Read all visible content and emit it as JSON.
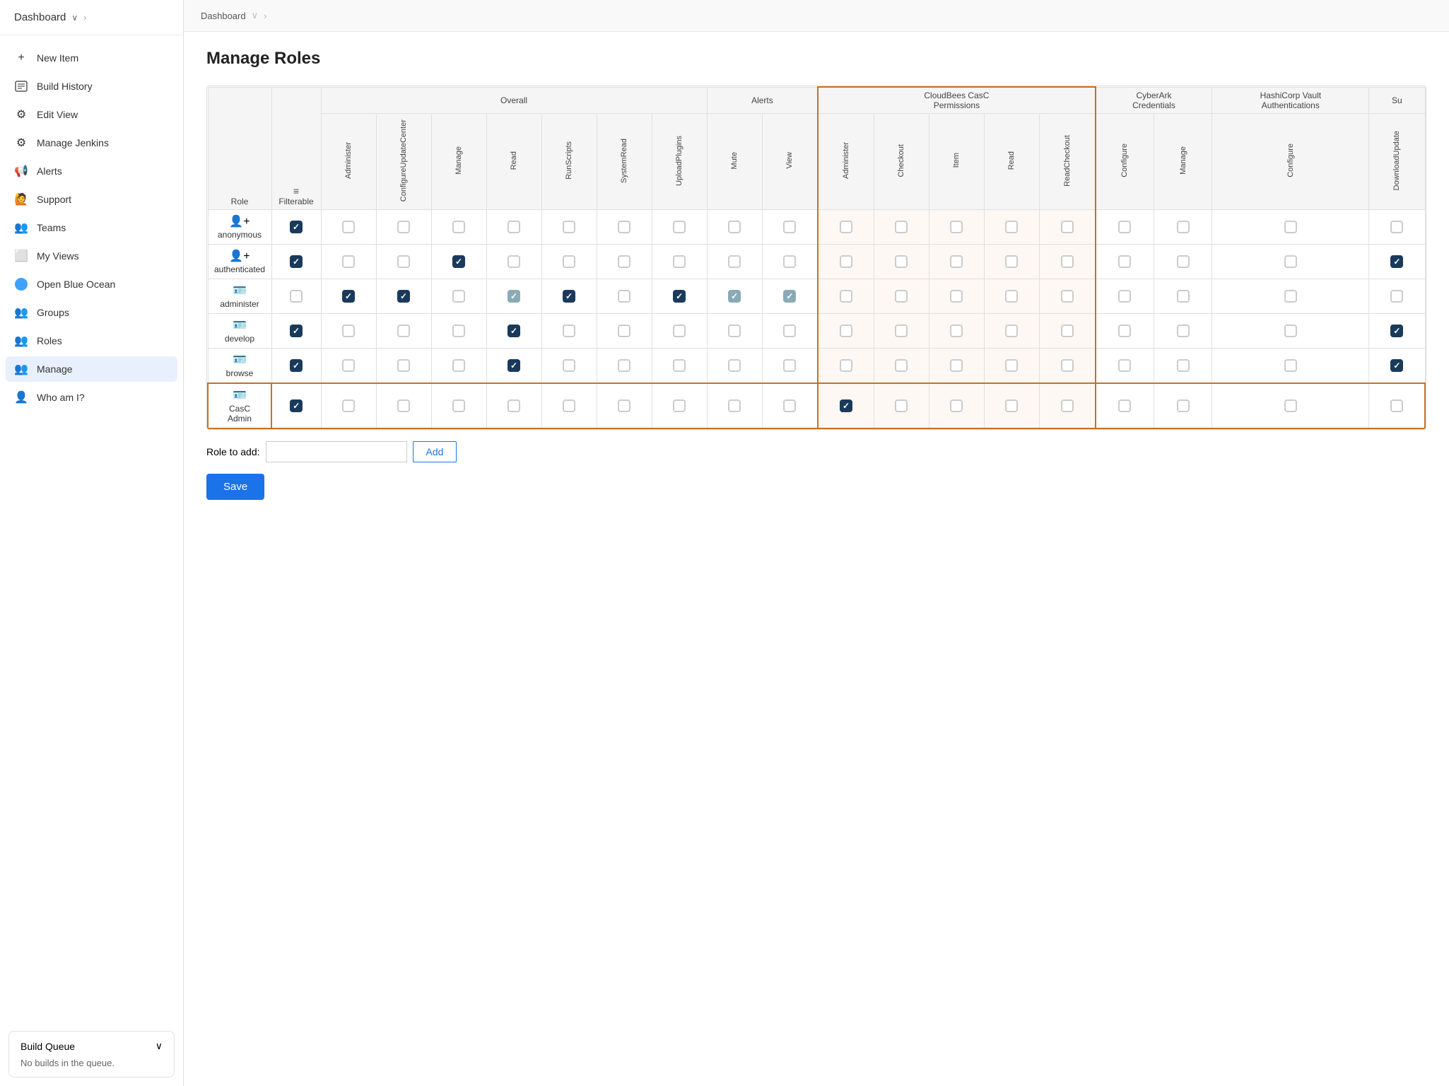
{
  "breadcrumb": {
    "items": [
      "Dashboard"
    ]
  },
  "sidebar": {
    "header": "Dashboard",
    "nav_items": [
      {
        "id": "new-item",
        "label": "New Item",
        "icon": "+"
      },
      {
        "id": "build-history",
        "label": "Build History",
        "icon": "📋"
      },
      {
        "id": "edit-view",
        "label": "Edit View",
        "icon": "⚙"
      },
      {
        "id": "manage-jenkins",
        "label": "Manage Jenkins",
        "icon": "⚙"
      },
      {
        "id": "alerts",
        "label": "Alerts",
        "icon": "🔔"
      },
      {
        "id": "support",
        "label": "Support",
        "icon": "👤"
      },
      {
        "id": "teams",
        "label": "Teams",
        "icon": "👥"
      },
      {
        "id": "my-views",
        "label": "My Views",
        "icon": "⬜"
      },
      {
        "id": "open-blue-ocean",
        "label": "Open Blue Ocean",
        "icon": "🔵"
      },
      {
        "id": "groups",
        "label": "Groups",
        "icon": "👥"
      },
      {
        "id": "roles",
        "label": "Roles",
        "icon": "👥"
      },
      {
        "id": "manage",
        "label": "Manage",
        "icon": "👥",
        "active": true,
        "sub": true
      },
      {
        "id": "who-am-i",
        "label": "Who am I?",
        "icon": "👤"
      }
    ],
    "build_queue": {
      "title": "Build Queue",
      "body": "No builds in the queue."
    }
  },
  "page": {
    "title": "Manage Roles",
    "table": {
      "role_col": "Role",
      "filterable_col": "Filterable",
      "groups": [
        {
          "label": "Overall",
          "cols": [
            "Administer",
            "ConfigureUpdateCenter",
            "Manage",
            "Read",
            "RunScripts",
            "SystemRead",
            "UploadPlugins"
          ]
        },
        {
          "label": "Alerts",
          "cols": [
            "Mute",
            "View"
          ]
        },
        {
          "label": "CloudBees CasC Permissions",
          "cols": [
            "Administer",
            "Checkout",
            "Item",
            "Read",
            "ReadCheckout"
          ],
          "highlight": true
        },
        {
          "label": "CyberArk Credentials",
          "cols": [
            "Configure",
            "Manage"
          ]
        },
        {
          "label": "HashiCorp Vault Authentications",
          "cols": [
            "Configure"
          ]
        },
        {
          "label": "Su",
          "cols": [
            "DownloadUpdate"
          ]
        }
      ],
      "rows": [
        {
          "name": "anonymous",
          "icon": "person_add",
          "filterable": true,
          "overall": [
            false,
            false,
            false,
            false,
            false,
            false,
            false
          ],
          "alerts": [
            false,
            false
          ],
          "casc": [
            false,
            false,
            false,
            false,
            false
          ],
          "cyberark": [
            false,
            false
          ],
          "hashicorp": [
            false
          ],
          "su": [
            false
          ]
        },
        {
          "name": "authenticated",
          "icon": "person_add",
          "filterable": true,
          "overall": [
            false,
            false,
            true,
            false,
            false,
            false,
            false
          ],
          "alerts": [
            false,
            false
          ],
          "casc": [
            false,
            false,
            false,
            false,
            false
          ],
          "cyberark": [
            false,
            false
          ],
          "hashicorp": [
            false
          ],
          "su": [
            true
          ]
        },
        {
          "name": "administer",
          "icon": "person_badge",
          "filterable": false,
          "overall": [
            true,
            true,
            false,
            true,
            true,
            false,
            true
          ],
          "overall_states": [
            "checked",
            "checked",
            "unchecked",
            "checked-light",
            "checked",
            "unchecked",
            "checked",
            "checked-light",
            "checked-light"
          ],
          "alerts": [
            true,
            "light"
          ],
          "casc": [
            false,
            false,
            false,
            false,
            false
          ],
          "cyberark": [
            false,
            false
          ],
          "hashicorp": [
            false
          ],
          "su": [
            false
          ]
        },
        {
          "name": "develop",
          "icon": "person_badge",
          "filterable": true,
          "overall": [
            false,
            false,
            false,
            true,
            false,
            false,
            false
          ],
          "alerts": [
            false,
            false
          ],
          "casc": [
            false,
            false,
            false,
            false,
            false
          ],
          "cyberark": [
            false,
            false
          ],
          "hashicorp": [
            false
          ],
          "su": [
            true
          ]
        },
        {
          "name": "browse",
          "icon": "person_badge",
          "filterable": true,
          "overall": [
            false,
            false,
            false,
            true,
            false,
            false,
            false
          ],
          "alerts": [
            false,
            false
          ],
          "casc": [
            false,
            false,
            false,
            false,
            false
          ],
          "cyberark": [
            false,
            false
          ],
          "hashicorp": [
            false
          ],
          "su": [
            true
          ]
        },
        {
          "name": "CasC Admin",
          "icon": "person_badge",
          "highlight_row": true,
          "filterable": true,
          "overall": [
            false,
            false,
            false,
            false,
            false,
            false,
            false
          ],
          "alerts": [
            false,
            false
          ],
          "casc": [
            true,
            false,
            false,
            false,
            false
          ],
          "cyberark": [
            false,
            false
          ],
          "hashicorp": [
            false
          ],
          "su": [
            false
          ]
        }
      ]
    },
    "role_add_label": "Role to add:",
    "role_add_placeholder": "",
    "add_button": "Add",
    "save_button": "Save"
  }
}
